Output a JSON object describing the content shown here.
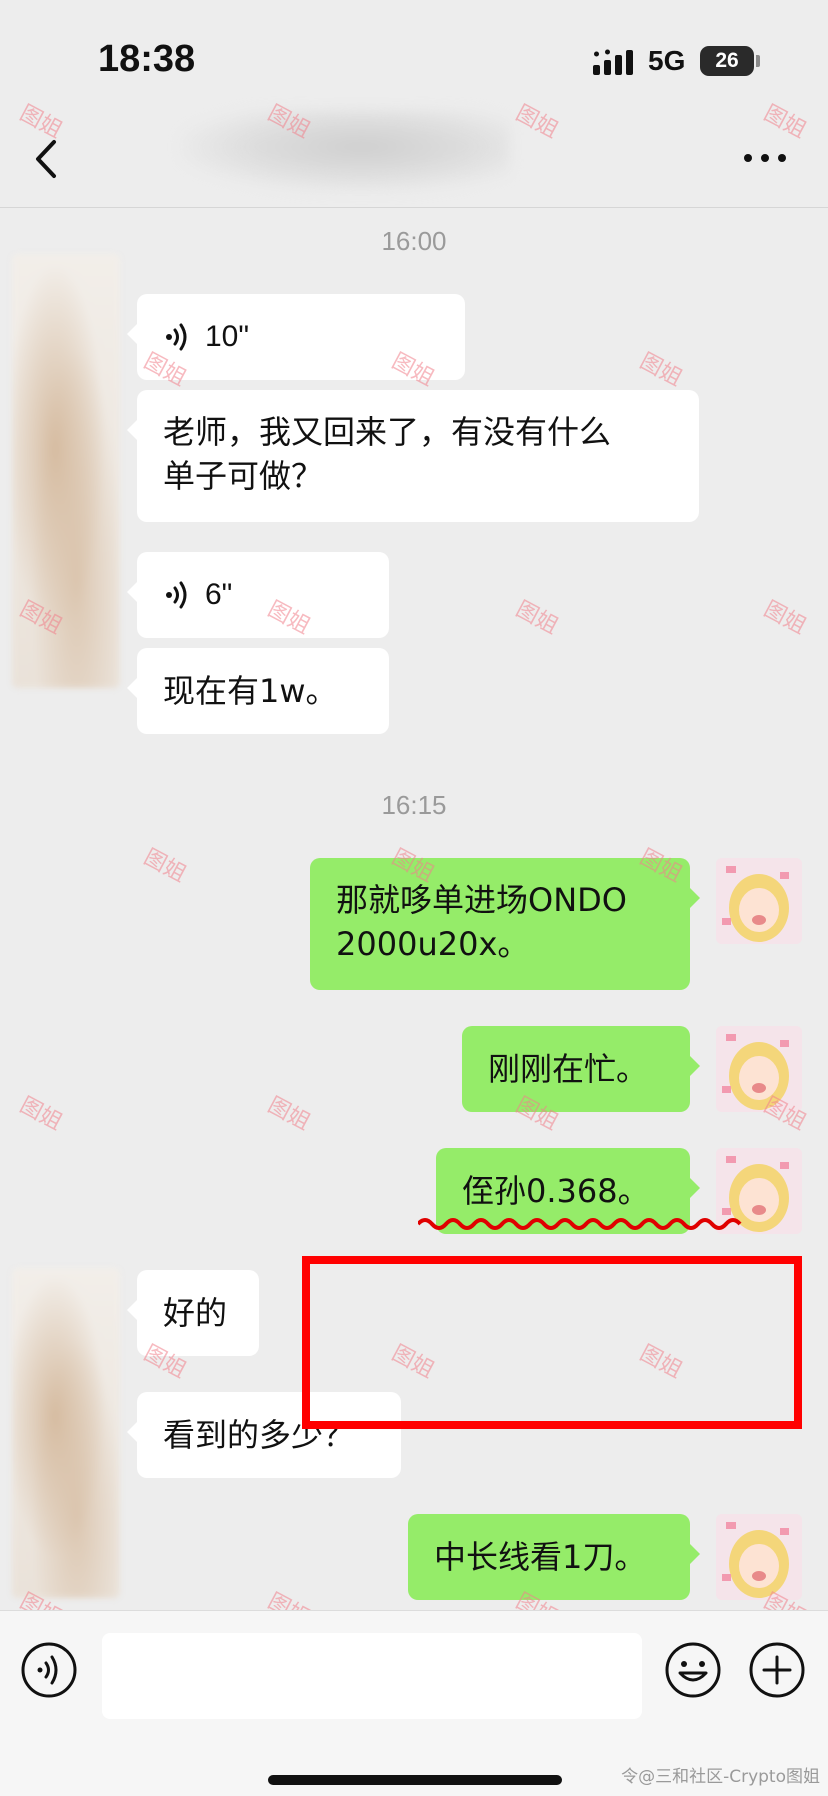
{
  "status_bar": {
    "time": "18:38",
    "network": "5G",
    "battery": "26"
  },
  "header": {
    "back_icon": "chevron-left-icon",
    "more_icon": "more-dots-icon"
  },
  "chat": {
    "timestamps": [
      "16:00",
      "16:15"
    ],
    "messages": [
      {
        "side": "in",
        "type": "voice",
        "duration": "10\""
      },
      {
        "side": "in",
        "type": "text",
        "lines": [
          "老师，我又回来了，有没有什么",
          "单子可做？"
        ]
      },
      {
        "side": "in",
        "type": "voice",
        "duration": "6\""
      },
      {
        "side": "in",
        "type": "text",
        "lines": [
          "现在有1w。"
        ]
      },
      {
        "side": "out",
        "type": "text",
        "lines": [
          "那就哆单进场ONDO",
          "2000u20x。"
        ]
      },
      {
        "side": "out",
        "type": "text",
        "lines": [
          "刚刚在忙。"
        ]
      },
      {
        "side": "out",
        "type": "text",
        "lines": [
          "侄孙0.368。"
        ]
      },
      {
        "side": "in",
        "type": "text",
        "lines": [
          "好的"
        ]
      },
      {
        "side": "in",
        "type": "text",
        "lines": [
          "看到的多少？"
        ]
      },
      {
        "side": "out",
        "type": "text",
        "lines": [
          "中长线看1刀。"
        ]
      }
    ]
  },
  "watermark": "图姐",
  "input_bar": {
    "voice_icon": "voice-wave-icon",
    "emoji_icon": "emoji-smile-icon",
    "plus_icon": "plus-circle-icon"
  },
  "footer": {
    "credit": "令@三和社区-Crypto图姐"
  },
  "colors": {
    "outgoing_bubble": "#95ec69",
    "incoming_bubble": "#ffffff",
    "background": "#ededed",
    "highlight": "#ff0000"
  }
}
